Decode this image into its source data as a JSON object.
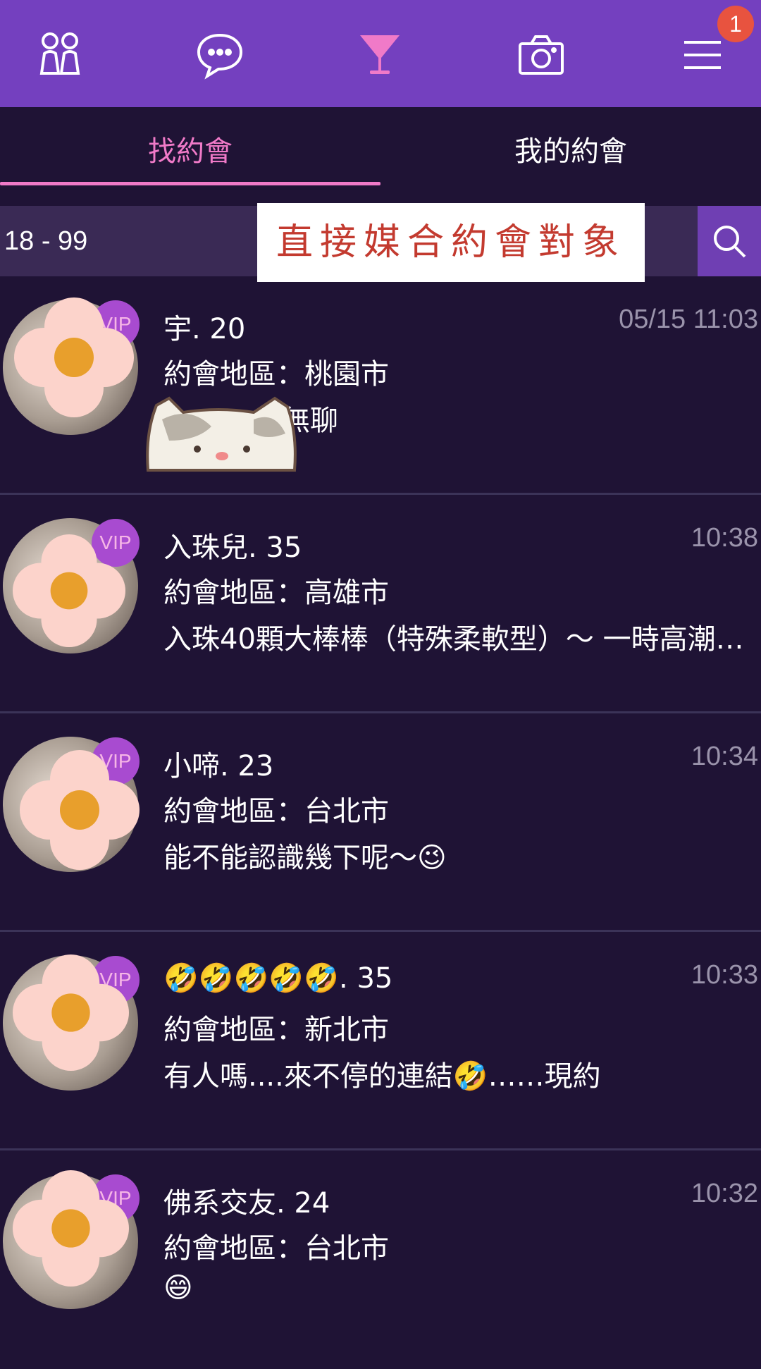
{
  "topbar": {
    "icons": [
      "people-icon",
      "chat-icon",
      "cocktail-icon",
      "camera-icon",
      "menu-icon"
    ],
    "badge": "1",
    "active_color": "#f07ac8",
    "bg_color": "#7440bf"
  },
  "tabs": [
    {
      "label": "找約會",
      "active": true
    },
    {
      "label": "我的約會",
      "active": false
    }
  ],
  "filter": {
    "age_range": "18 - 99"
  },
  "caption": "直接媒合約會對象",
  "list": [
    {
      "name": "宇. 20",
      "time": "05/15 11:03",
      "region": "約會地區：桃園市",
      "message": "無聊",
      "vip": "VIP"
    },
    {
      "name": "入珠兒. 35",
      "time": "10:38",
      "region": "約會地區：高雄市",
      "message": "入珠40顆大棒棒（特殊柔軟型）～ 一時高潮…",
      "vip": "VIP"
    },
    {
      "name": "小啼. 23",
      "time": "10:34",
      "region": "約會地區：台北市",
      "message": "能不能認識幾下呢～😉",
      "vip": "VIP"
    },
    {
      "name": "🤣🤣🤣🤣🤣. 35",
      "time": "10:33",
      "region": "約會地區：新北市",
      "message": "有人嗎....來不停的連結🤣……現約",
      "vip": "VIP"
    },
    {
      "name": "佛系交友. 24",
      "time": "10:32",
      "region": "約會地區：台北市",
      "message": "😄",
      "vip": "VIP"
    }
  ]
}
